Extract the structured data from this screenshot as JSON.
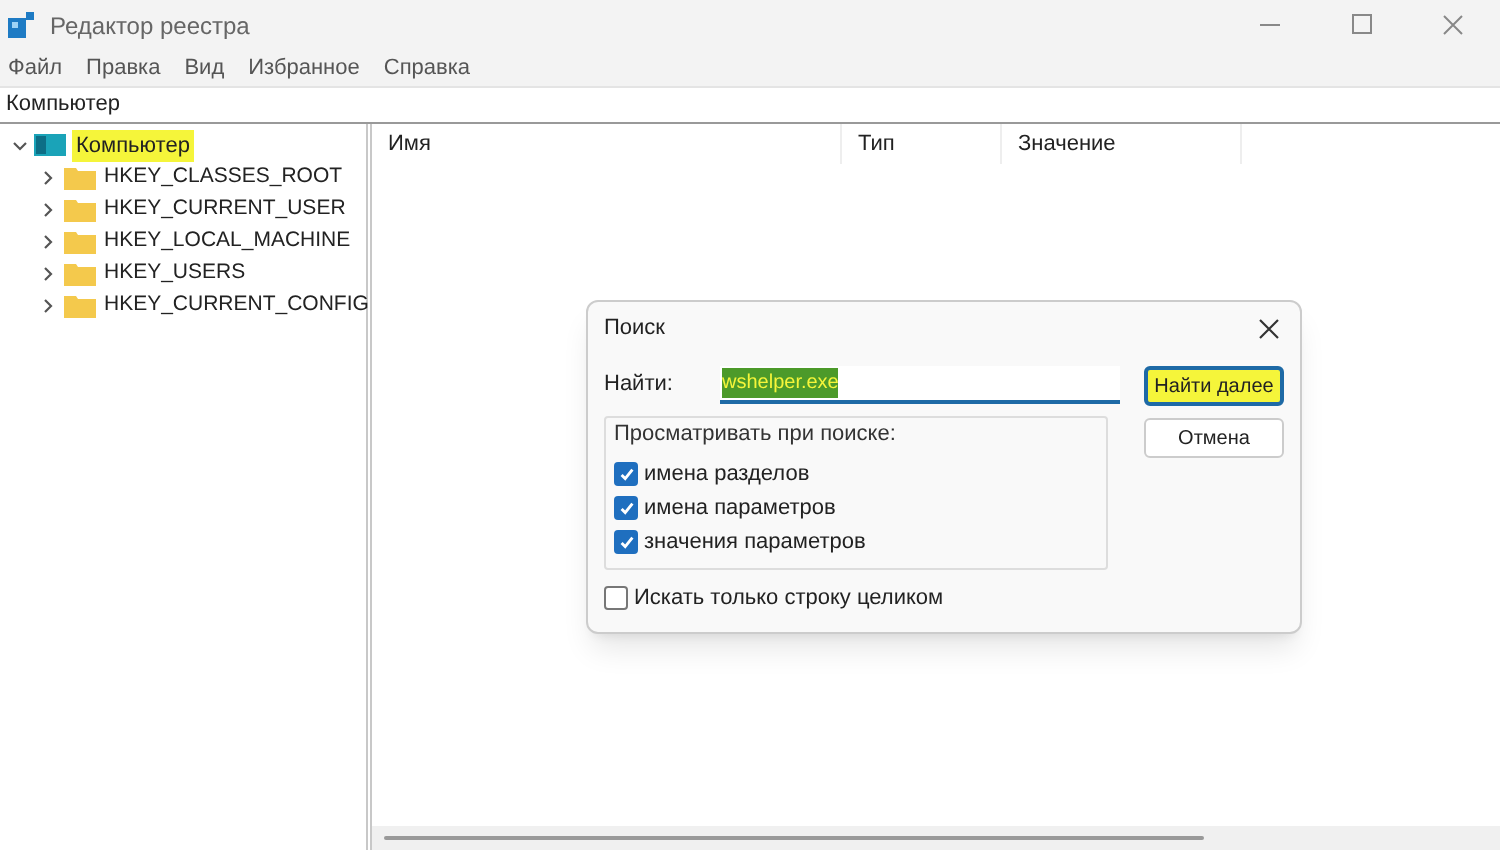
{
  "window": {
    "title": "Редактор реестра"
  },
  "menu": [
    "Файл",
    "Правка",
    "Вид",
    "Избранное",
    "Справка"
  ],
  "address_bar": "Компьютер",
  "tree": [
    {
      "label": "Компьютер",
      "expanded": true,
      "highlighted": true,
      "children": [
        {
          "label": "HKEY_CLASSES_ROOT",
          "expanded": false
        },
        {
          "label": "HKEY_CURRENT_USER",
          "expanded": false
        },
        {
          "label": "HKEY_LOCAL_MACHINE",
          "expanded": false
        },
        {
          "label": "HKEY_USERS",
          "expanded": false
        },
        {
          "label": "HKEY_CURRENT_CONFIG",
          "expanded": false
        }
      ]
    }
  ],
  "table": {
    "columns": [
      "Имя",
      "Тип",
      "Значение"
    ]
  },
  "dialog": {
    "title": "Поиск",
    "find_label": "Найти:",
    "find_value": "wshelper.exe",
    "find_highlighted": true,
    "group_title": "Просматривать при поиске:",
    "options": [
      {
        "label": "имена разделов",
        "checked": true
      },
      {
        "label": "имена параметров",
        "checked": true
      },
      {
        "label": "значения параметров",
        "checked": true
      }
    ],
    "whole_string": {
      "label": "Искать только строку целиком",
      "checked": false
    },
    "buttons": [
      {
        "label": "Найти далее",
        "highlighted": true,
        "default": true
      },
      {
        "label": "Отмена",
        "highlighted": false,
        "default": false
      }
    ]
  }
}
